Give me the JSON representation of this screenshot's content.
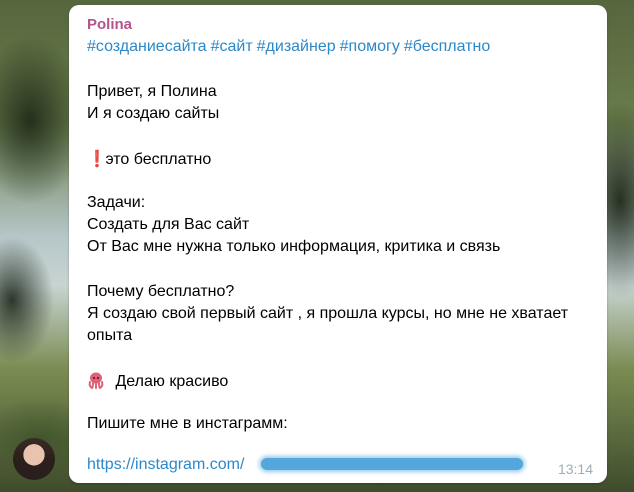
{
  "message": {
    "sender": "Polina",
    "hashtags": [
      "#созданиесайта",
      "#сайт",
      "#дизайнер",
      "#помогу",
      "#бесплатно"
    ],
    "greeting_1": "Привет, я Полина",
    "greeting_2": "И я создаю сайты",
    "free_emoji": "❗",
    "free_text": "это бесплатно",
    "tasks_heading": "Задачи:",
    "task_1": "Создать для Вас сайт",
    "task_2": "От Вас мне нужна только информация, критика и связь",
    "why_heading": "Почему бесплатно?",
    "why_1": "Я создаю свой первый сайт , я прошла курсы, но мне не хватает",
    "why_2": "опыта",
    "octopus_text": "Делаю красиво",
    "contact_text": "Пишите мне в инстаграмм:",
    "link_visible": "https://instagram.com/",
    "time": "13:14"
  },
  "colors": {
    "sender": "#b5538e",
    "link": "#2c88c8",
    "time": "#a0acb6",
    "bubble": "#ffffff"
  }
}
